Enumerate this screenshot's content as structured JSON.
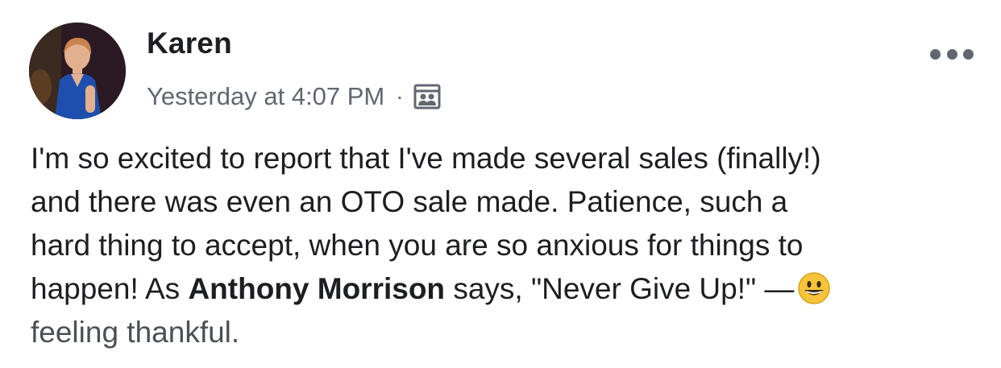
{
  "post": {
    "author": "Karen",
    "timestamp": "Yesterday at 4:07 PM",
    "separator": "·",
    "audience_icon": "friends-audience-icon",
    "more_icon": "more-options-icon",
    "body_lines": [
      "I'm so excited to report that I've made several sales (finally!)",
      "and there was even an OTO sale made. Patience, such a",
      "hard thing to accept, when you are so anxious for things to"
    ],
    "line4_before": "happen! As ",
    "mention": "Anthony Morrison",
    "line4_after": " says, \"Never Give Up!\" —",
    "feeling_emoji": "grinning-face-emoji",
    "feeling_text": "feeling thankful.",
    "colors": {
      "text": "#1c1e21",
      "meta": "#606770",
      "emoji": "#f7c439"
    }
  }
}
